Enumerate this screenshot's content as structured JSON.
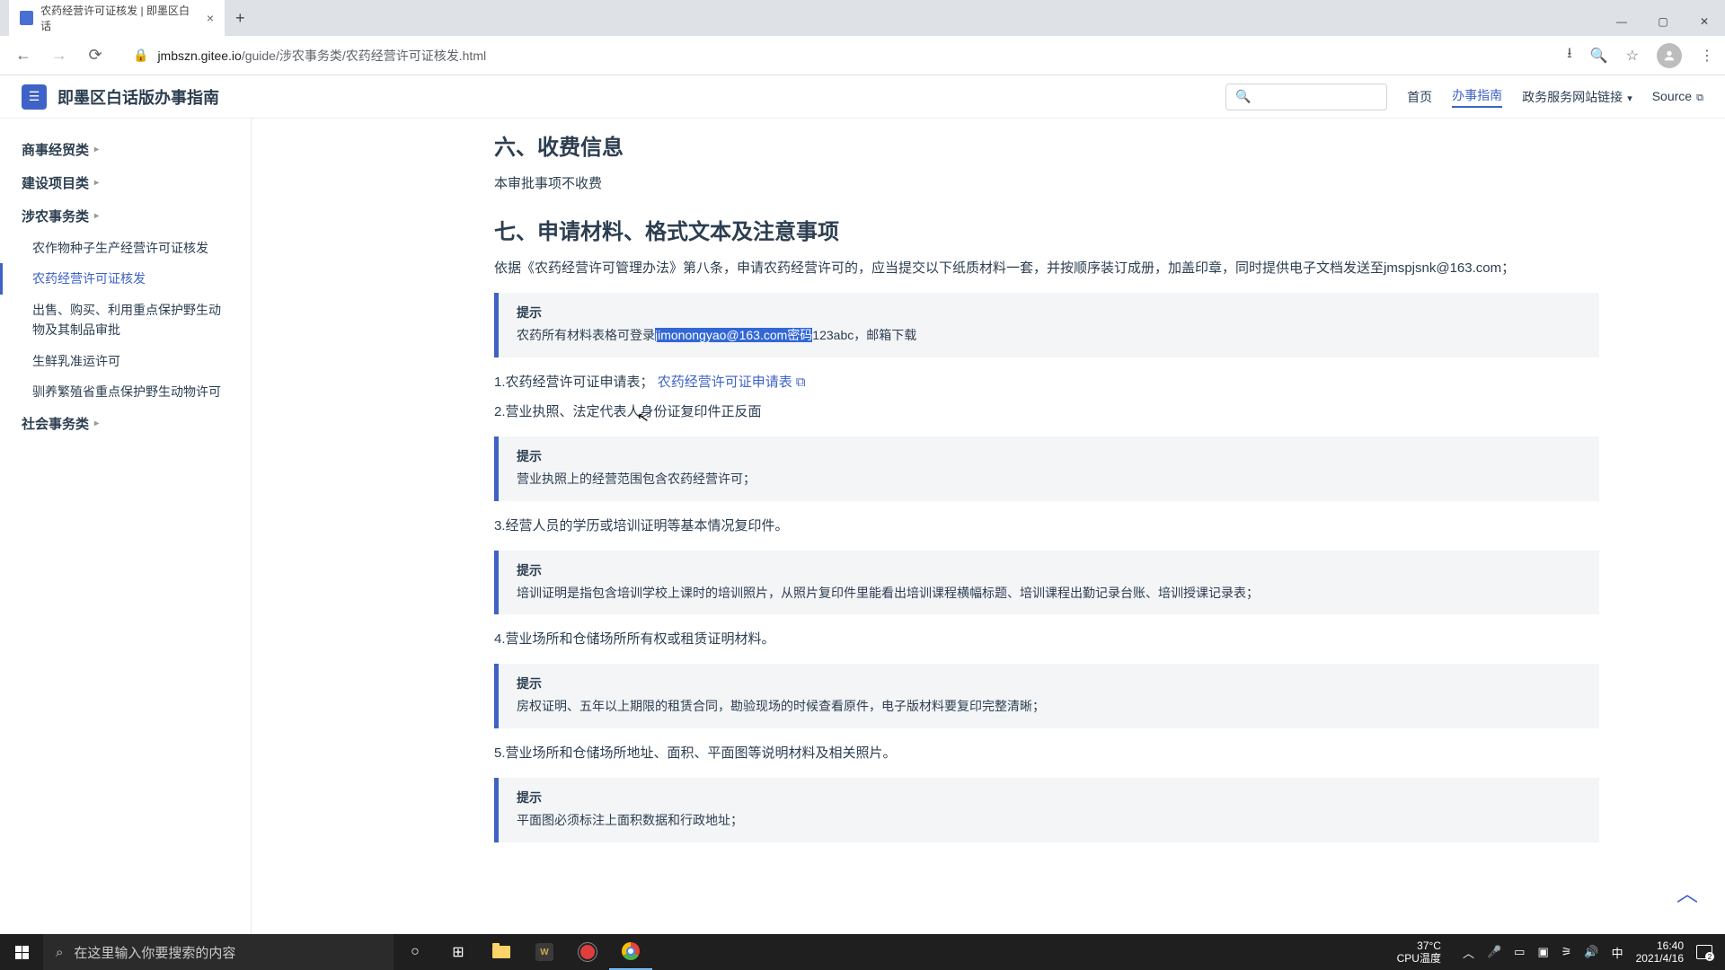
{
  "browser": {
    "tab_title": "农药经营许可证核发 | 即墨区白话",
    "url_host": "jmbszn.gitee.io",
    "url_path": "/guide/涉农事务类/农药经营许可证核发.html"
  },
  "site": {
    "title": "即墨区白话版办事指南",
    "nav": {
      "home": "首页",
      "guide": "办事指南",
      "gov_links": "政务服务网站链接",
      "source": "Source"
    }
  },
  "sidebar": {
    "groups": [
      {
        "label": "商事经贸类"
      },
      {
        "label": "建设项目类"
      },
      {
        "label": "涉农事务类",
        "items": [
          "农作物种子生产经营许可证核发",
          "农药经营许可证核发",
          "出售、购买、利用重点保护野生动物及其制品审批",
          "生鲜乳准运许可",
          "驯养繁殖省重点保护野生动物许可"
        ],
        "active_index": 1
      },
      {
        "label": "社会事务类"
      }
    ]
  },
  "content": {
    "h6": "六、收费信息",
    "p6": "本审批事项不收费",
    "h7": "七、申请材料、格式文本及注意事项",
    "p7_intro": "依据《农药经营许可管理办法》第八条，申请农药经营许可的，应当提交以下纸质材料一套，并按顺序装订成册，加盖印章，同时提供电子文档发送至jmspjsnk@163.com；",
    "tip1_title": "提示",
    "tip1_prefix": "农药所有材料表格可登录",
    "tip1_highlight": "jimonongyao@163.com密码",
    "tip1_suffix": "123abc，邮箱下载",
    "item1_prefix": "1.农药经营许可证申请表；",
    "item1_link": "农药经营许可证申请表",
    "item2": "2.营业执照、法定代表人身份证复印件正反面",
    "tip2_title": "提示",
    "tip2": "营业执照上的经营范围包含农药经营许可；",
    "item3": "3.经营人员的学历或培训证明等基本情况复印件。",
    "tip3_title": "提示",
    "tip3": "培训证明是指包含培训学校上课时的培训照片，从照片复印件里能看出培训课程横幅标题、培训课程出勤记录台账、培训授课记录表；",
    "item4": "4.营业场所和仓储场所所有权或租赁证明材料。",
    "tip4_title": "提示",
    "tip4": "房权证明、五年以上期限的租赁合同，勘验现场的时候查看原件，电子版材料要复印完整清晰；",
    "item5": "5.营业场所和仓储场所地址、面积、平面图等说明材料及相关照片。",
    "tip5_title": "提示",
    "tip5": "平面图必须标注上面积数据和行政地址；"
  },
  "taskbar": {
    "search_placeholder": "在这里输入你要搜索的内容",
    "temp": "37°C",
    "cpu": "CPU温度",
    "ime": "中",
    "time": "16:40",
    "date": "2021/4/16"
  }
}
